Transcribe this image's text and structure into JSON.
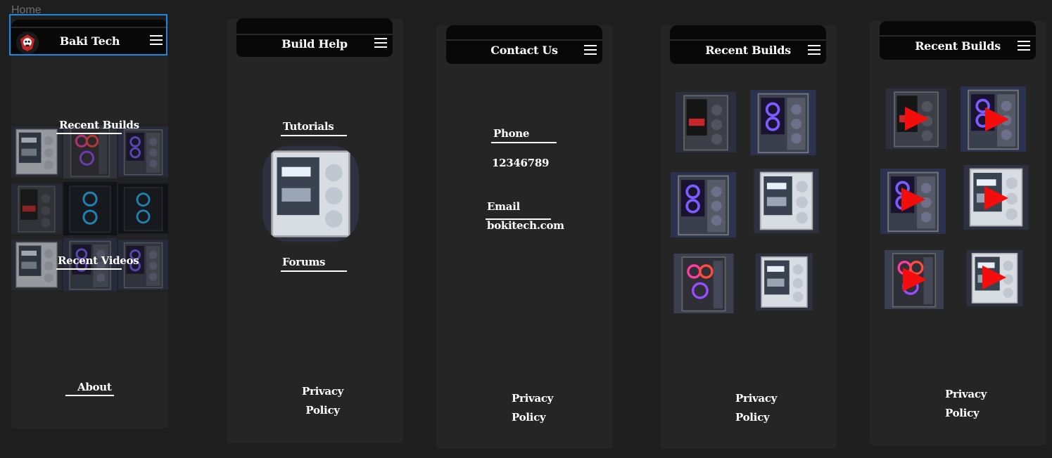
{
  "canvas": {
    "label": "Home"
  },
  "frames": {
    "home": {
      "header_title": "Baki Tech",
      "recent_builds": "Recent Builds",
      "recent_videos": "Recent Videos",
      "about": "About"
    },
    "build_help": {
      "header_title": "Build Help",
      "tutorials": "Tutorials",
      "forums": "Forums",
      "privacy_line1": "Privacy",
      "privacy_line2": "Policy"
    },
    "contact": {
      "header_title": "Contact Us",
      "phone_label": "Phone",
      "phone_value": "12346789",
      "email_label": "Email",
      "email_value": "bokitech.com",
      "privacy_line1": "Privacy",
      "privacy_line2": "Policy"
    },
    "recent_builds": {
      "header_title": "Recent Builds",
      "privacy_line1": "Privacy",
      "privacy_line2": "Policy"
    },
    "recent_videos": {
      "header_title": "Recent Builds",
      "privacy_line1": "Privacy",
      "privacy_line2": "Policy"
    }
  },
  "colors": {
    "selection": "#1e88e5",
    "play": "#f30d0d",
    "frame": "#252525",
    "header": "#080808"
  }
}
